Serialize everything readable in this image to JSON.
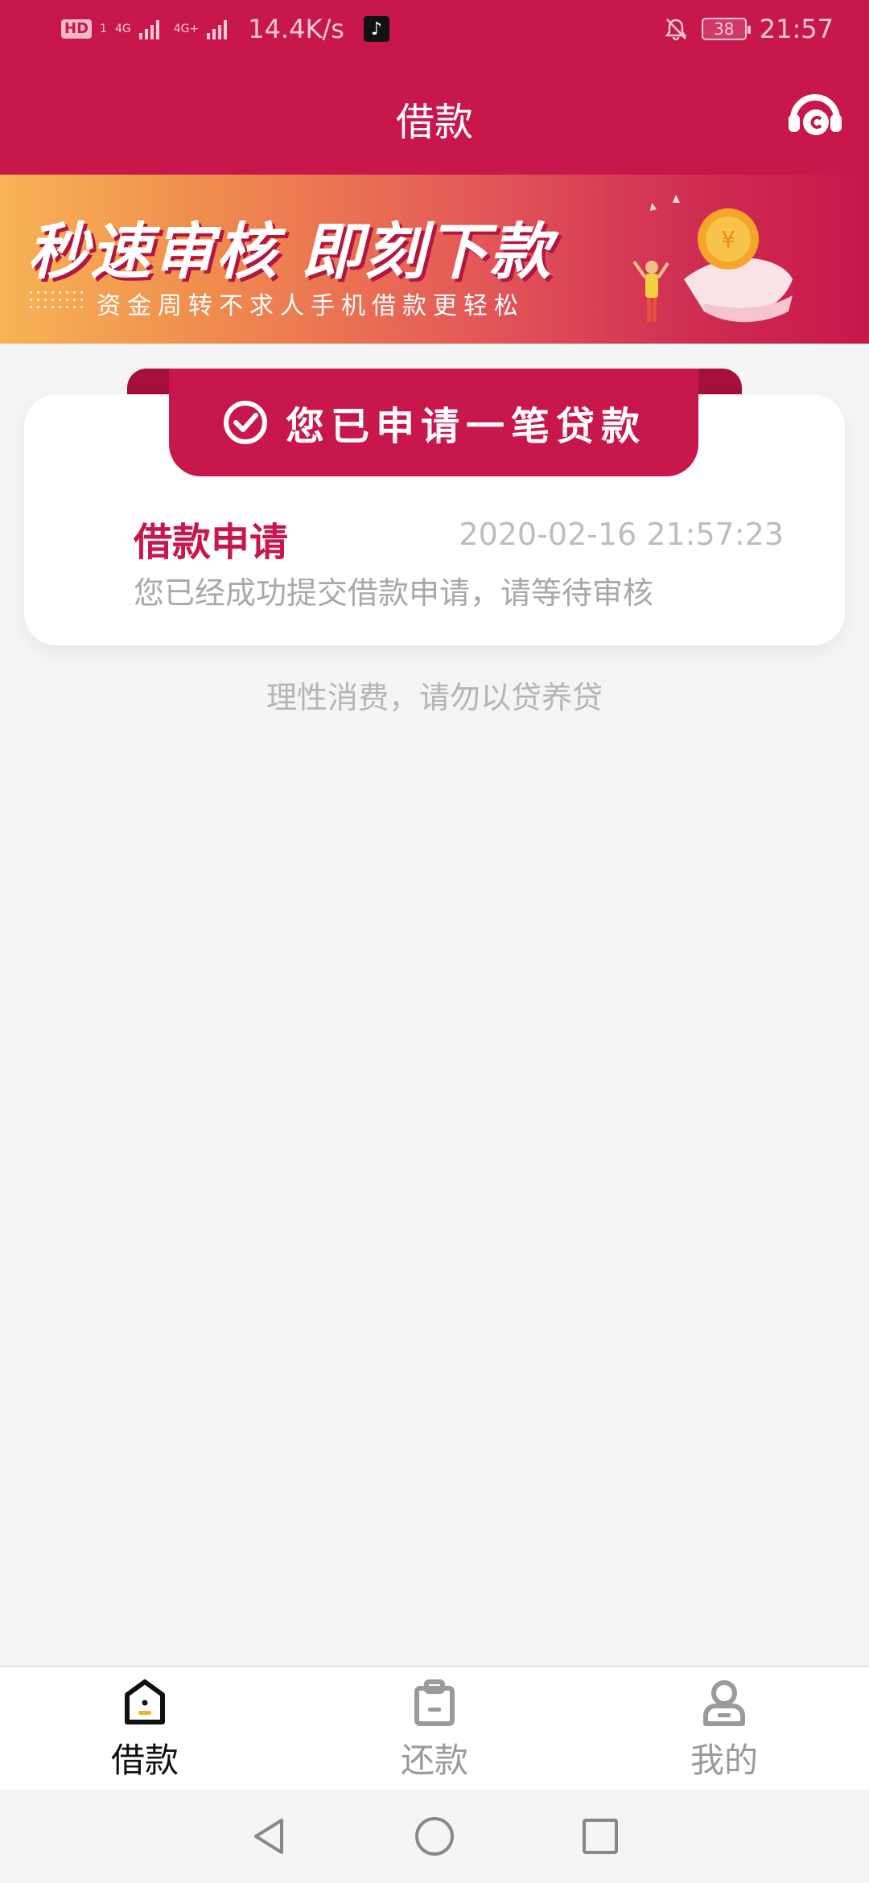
{
  "status_bar": {
    "hd": "HD",
    "sim": "1",
    "net1": "4G",
    "net2": "4G+",
    "speed": "14.4K/s",
    "battery": "38",
    "time": "21:57"
  },
  "header": {
    "title": "借款"
  },
  "banner": {
    "title": "秒速审核  即刻下款",
    "subtitle": "资金周转不求人手机借款更轻松"
  },
  "card": {
    "ribbon": "您已申请一笔贷款",
    "title": "借款申请",
    "time": "2020-02-16 21:57:23",
    "description": "您已经成功提交借款申请，请等待审核"
  },
  "tip": "理性消费，请勿以贷养贷",
  "bottom_nav": [
    {
      "label": "借款",
      "icon": "borrow-icon",
      "active": true
    },
    {
      "label": "还款",
      "icon": "repay-icon",
      "active": false
    },
    {
      "label": "我的",
      "icon": "profile-icon",
      "active": false
    }
  ],
  "colors": {
    "primary": "#c8174a",
    "background": "#f5f5f5"
  }
}
